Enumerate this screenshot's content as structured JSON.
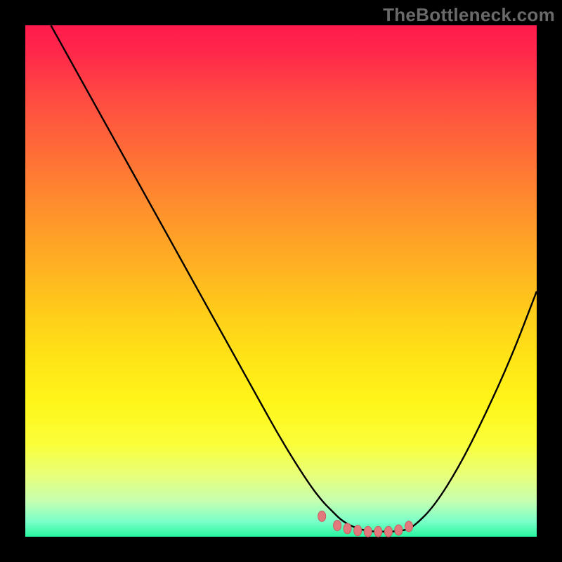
{
  "watermark": "TheBottleneck.com",
  "colors": {
    "curve": "#000000",
    "dot_fill": "#e27a7d",
    "dot_stroke": "#c85d60"
  },
  "chart_data": {
    "type": "line",
    "title": "",
    "xlabel": "",
    "ylabel": "",
    "xlim": [
      0,
      100
    ],
    "ylim": [
      0,
      100
    ],
    "series": [
      {
        "name": "bottleneck-curve",
        "x": [
          5,
          10,
          15,
          20,
          25,
          30,
          35,
          40,
          45,
          50,
          55,
          58,
          60,
          62,
          65,
          68,
          70,
          72,
          74,
          76,
          80,
          85,
          90,
          95,
          100
        ],
        "y": [
          100,
          91,
          82,
          73,
          64,
          55,
          46,
          37,
          28,
          19,
          11,
          7,
          5,
          3,
          1.5,
          1,
          1,
          1,
          1.2,
          2,
          6,
          14,
          24,
          35,
          48
        ]
      }
    ],
    "markers": {
      "name": "highlight-dots",
      "x": [
        58,
        61,
        63,
        65,
        67,
        69,
        71,
        73,
        75
      ],
      "y": [
        4.0,
        2.2,
        1.6,
        1.2,
        1.0,
        1.0,
        1.0,
        1.3,
        2.0
      ]
    }
  }
}
